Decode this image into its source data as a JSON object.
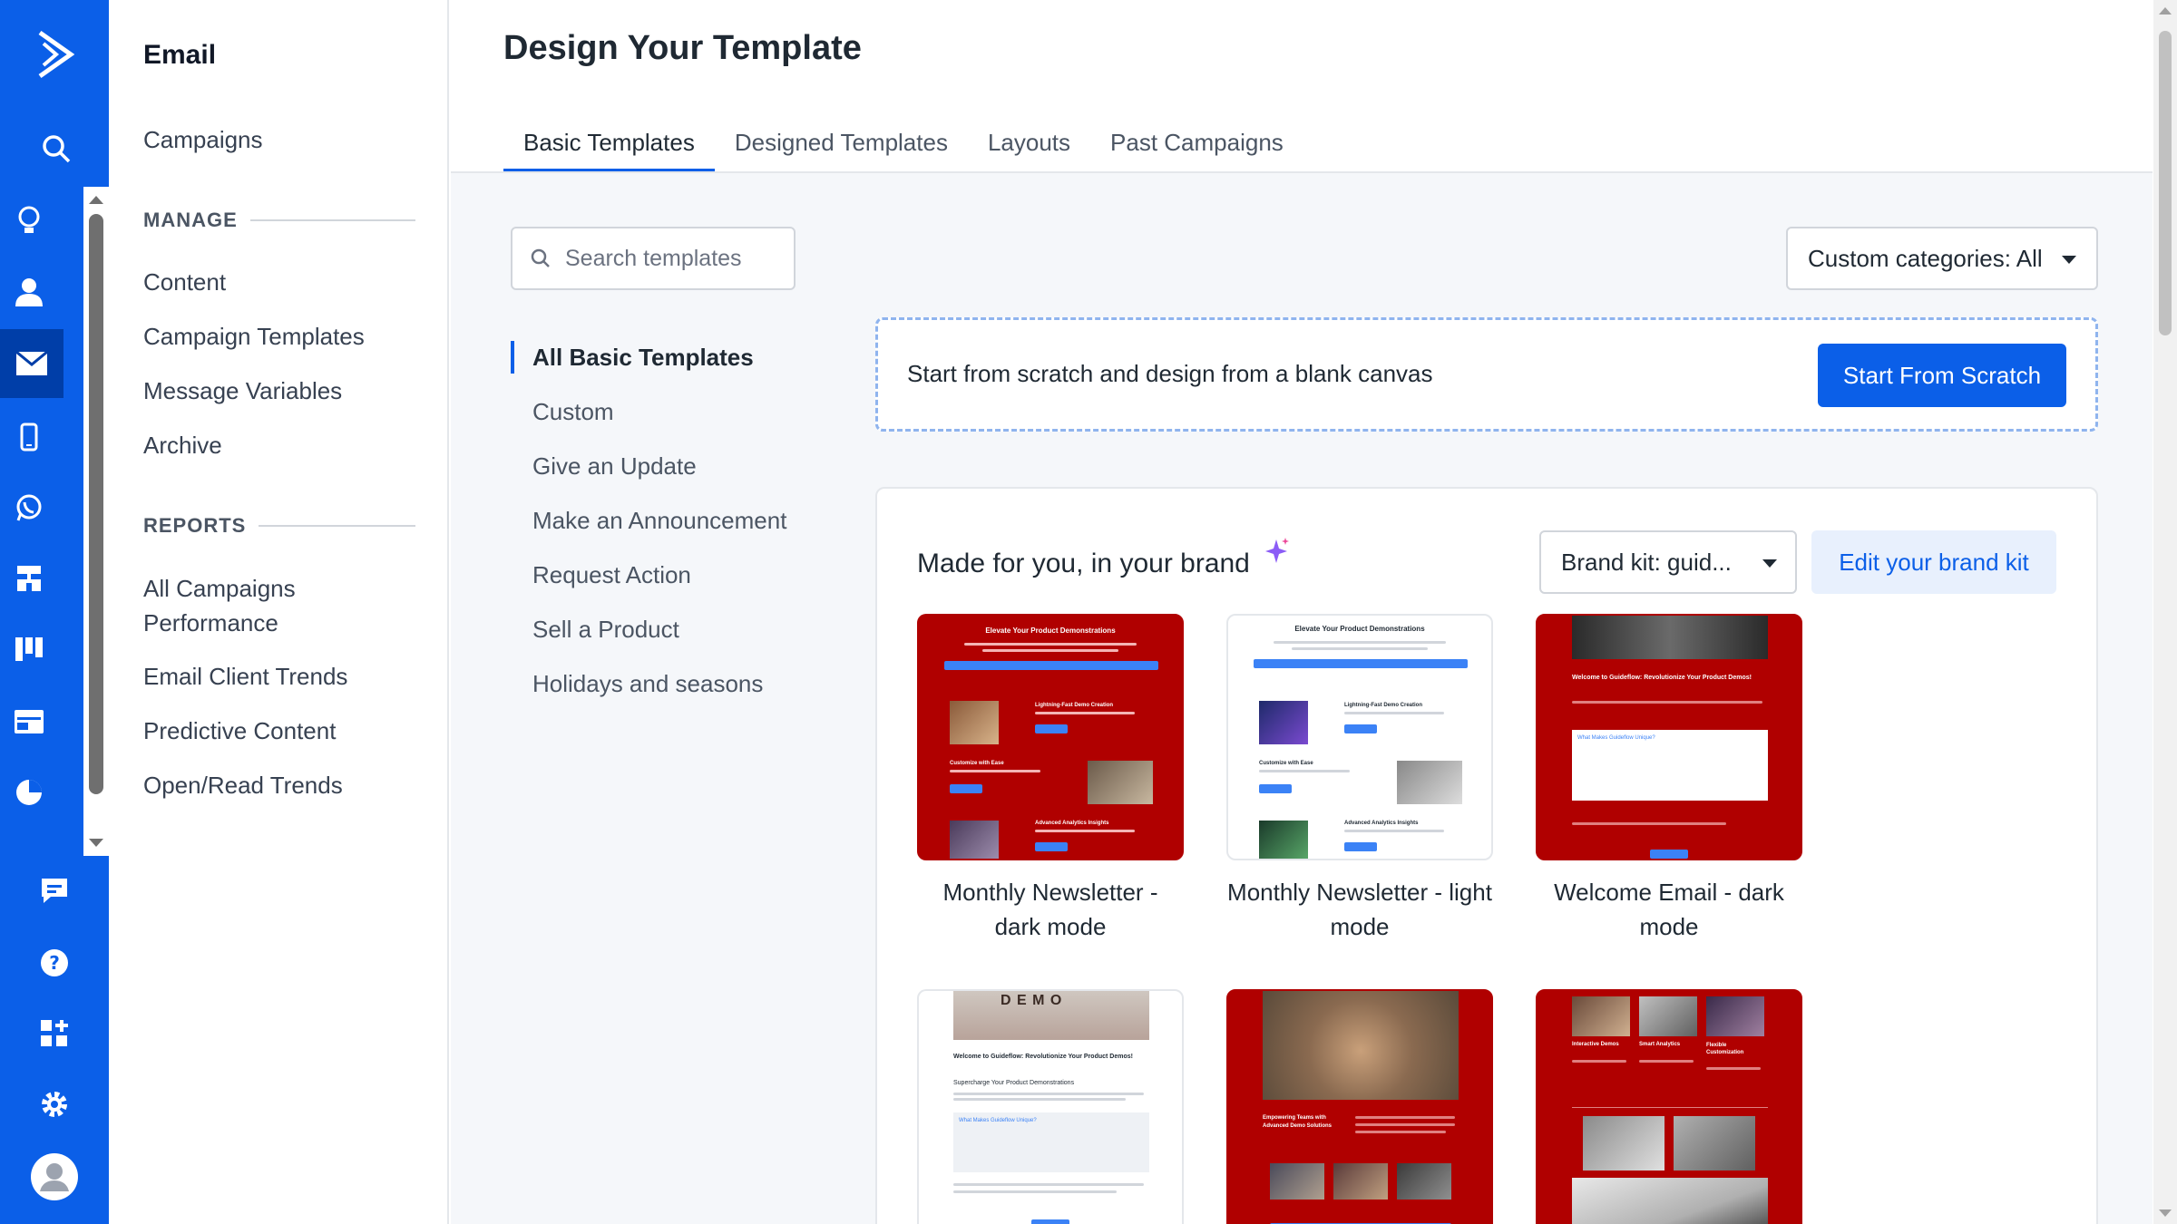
{
  "app": {
    "accent": "#0b5fe8",
    "rail_color": "#0b5fe8"
  },
  "rail": {
    "icons": [
      "logo-icon",
      "search-icon",
      "lightbulb-icon",
      "contacts-icon",
      "email-icon",
      "mobile-icon",
      "whatsapp-icon",
      "automations-icon",
      "deals-icon",
      "website-icon",
      "reports-icon",
      "chat-icon",
      "help-icon",
      "apps-icon",
      "settings-icon",
      "avatar-icon"
    ],
    "active": "email-icon"
  },
  "sidebar": {
    "title": "Email",
    "top_item": "Campaigns",
    "manage_heading": "MANAGE",
    "manage_items": [
      "Content",
      "Campaign Templates",
      "Message Variables",
      "Archive"
    ],
    "reports_heading": "REPORTS",
    "reports_items": [
      "All Campaigns Performance",
      "Email Client Trends",
      "Predictive Content",
      "Open/Read Trends"
    ]
  },
  "main": {
    "title": "Design Your Template",
    "tabs": [
      "Basic Templates",
      "Designed Templates",
      "Layouts",
      "Past Campaigns"
    ],
    "active_tab": "Basic Templates",
    "search_placeholder": "Search templates",
    "categories": [
      "All Basic Templates",
      "Custom",
      "Give an Update",
      "Make an Announcement",
      "Request Action",
      "Sell a Product",
      "Holidays and seasons"
    ],
    "active_category": "All Basic Templates",
    "custom_categories_label": "Custom categories: All",
    "scratch_text": "Start from scratch and design from a blank canvas",
    "scratch_button": "Start From Scratch",
    "brand_title": "Made for you, in your brand",
    "brand_kit_label": "Brand kit: guid...",
    "brand_kit_edit": "Edit your brand kit",
    "templates": [
      {
        "name": "Monthly Newsletter - dark mode",
        "theme": "dark-red"
      },
      {
        "name": "Monthly Newsletter - light mode",
        "theme": "light"
      },
      {
        "name": "Welcome Email - dark mode",
        "theme": "dark-red"
      },
      {
        "name": "",
        "theme": "light"
      },
      {
        "name": "",
        "theme": "dark-red"
      },
      {
        "name": "",
        "theme": "dark-red"
      }
    ],
    "thumb_text": {
      "newsletter_headline": "Elevate Your Product Demonstrations",
      "sec1": "Lightning-Fast Demo Creation",
      "sec2": "Customize with Ease",
      "sec3": "Advanced Analytics Insights",
      "welcome_headline": "Welcome to Guideflow: Revolutionize Your Product Demos!",
      "welcome_box": "What Makes Guideflow Unique?",
      "demo_letters": "D E M O",
      "demo_subhead": "Supercharge Your Product Demonstrations",
      "team_heading": "Empowering Teams with Advanced Demo Solutions",
      "col_a": "Interactive Demos",
      "col_b": "Smart Analytics",
      "col_c": "Flexible Customization"
    }
  }
}
